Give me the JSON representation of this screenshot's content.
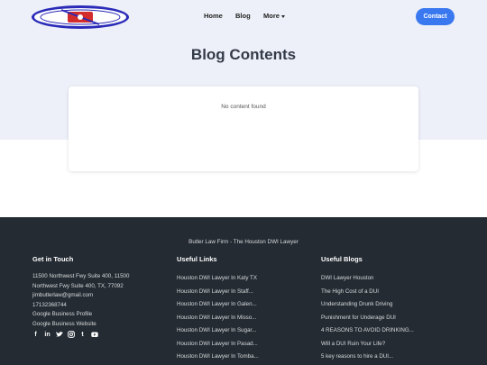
{
  "nav": {
    "home": "Home",
    "blog": "Blog",
    "more": "More",
    "contact": "Contact"
  },
  "page": {
    "title": "Blog Contents",
    "empty_message": "No content found"
  },
  "footer": {
    "firm": "Butler Law Firm - The Houston DWI Lawyer",
    "touch": {
      "heading": "Get in Touch",
      "address_line1": "11500 Northwest Fwy Suite 400, 11500",
      "address_line2": "Northwest Fwy Suite 400, TX, 77092",
      "email": "jimbutlerlaw@gmail.com",
      "phone": "17132368744",
      "profile": "Google Business Profile",
      "website": "Google Business Website",
      "socials": [
        "facebook-icon",
        "linkedin-icon",
        "twitter-icon",
        "instagram-icon",
        "tumblr-icon",
        "youtube-icon"
      ]
    },
    "links": {
      "heading": "Useful Links",
      "items": [
        "Houston DWI Lawyer In Katy TX",
        "Houston DWI Lawyer In Staff...",
        "Houston DWI Lawyer In Galen...",
        "Houston DWI Lawyer In Misso...",
        "Houston DWI Lawyer In Sugar...",
        "Houston DWI Lawyer In Pasad...",
        "Houston DWI Lawyer In Tomba..."
      ]
    },
    "blogs": {
      "heading": "Useful Blogs",
      "items": [
        "DWI Lawyer Houston",
        "The High Cost of a DUI",
        "Understanding Drunk Driving",
        "Punishment for Underage DUI",
        "4 REASONS TO AVOID DRINKING...",
        "Will a DUI Ruin Your Life?",
        "5 key reasons to hire a DUI..."
      ]
    }
  },
  "colors": {
    "accent": "#3a78f0",
    "hero_bg": "#eef0f9",
    "footer_bg": "#242b33"
  }
}
